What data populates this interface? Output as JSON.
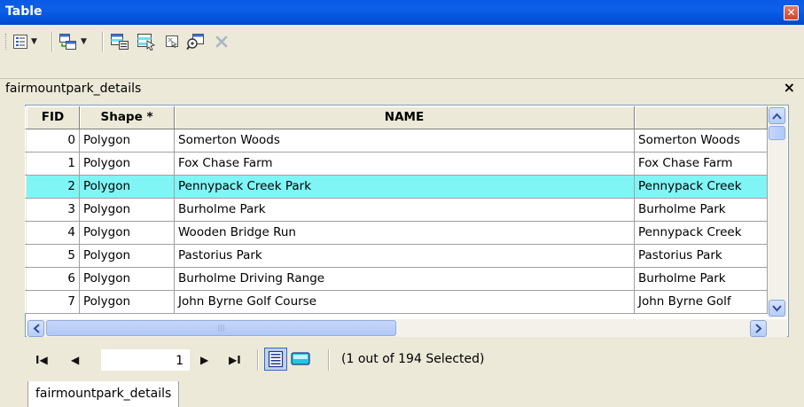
{
  "window": {
    "title": "Table",
    "close_glyph": "✕"
  },
  "toolbar": {
    "buttons": [
      {
        "name": "table-options-icon"
      },
      {
        "name": "related-tables-icon"
      },
      {
        "name": "select-by-attributes-icon"
      },
      {
        "name": "switch-selection-icon"
      },
      {
        "name": "clear-selection-icon"
      },
      {
        "name": "zoom-to-selected-icon"
      },
      {
        "name": "delete-selected-icon"
      }
    ]
  },
  "table": {
    "name": "fairmountpark_details",
    "close_glyph": "×",
    "columns": [
      "FID",
      "Shape *",
      "NAME",
      ""
    ],
    "rows": [
      {
        "fid": "0",
        "shape": "Polygon",
        "name": "Somerton Woods",
        "name2": "Somerton Woods",
        "current": true,
        "selected": false
      },
      {
        "fid": "1",
        "shape": "Polygon",
        "name": "Fox Chase Farm",
        "name2": "Fox Chase Farm",
        "current": false,
        "selected": false
      },
      {
        "fid": "2",
        "shape": "Polygon",
        "name": "Pennypack Creek Park",
        "name2": "Pennypack Creek",
        "current": false,
        "selected": true
      },
      {
        "fid": "3",
        "shape": "Polygon",
        "name": "Burholme Park",
        "name2": "Burholme Park",
        "current": false,
        "selected": false
      },
      {
        "fid": "4",
        "shape": "Polygon",
        "name": "Wooden Bridge Run",
        "name2": "Pennypack Creek",
        "current": false,
        "selected": false
      },
      {
        "fid": "5",
        "shape": "Polygon",
        "name": "Pastorius Park",
        "name2": "Pastorius Park",
        "current": false,
        "selected": false
      },
      {
        "fid": "6",
        "shape": "Polygon",
        "name": "Burholme Driving Range",
        "name2": "Burholme Park",
        "current": false,
        "selected": false
      },
      {
        "fid": "7",
        "shape": "Polygon",
        "name": "John Byrne Golf Course",
        "name2": "John Byrne Golf",
        "current": false,
        "selected": false
      }
    ]
  },
  "navigation": {
    "first": "I◀",
    "prev": "◀",
    "record": "1",
    "next": "▶",
    "last": "▶I",
    "status": "(1 out of 194 Selected)"
  },
  "tabs": [
    {
      "label": "fairmountpark_details"
    }
  ],
  "colors": {
    "title_bar": "#0a5ae6",
    "selected_row": "#7ff5f5",
    "chrome": "#ece9d8"
  }
}
